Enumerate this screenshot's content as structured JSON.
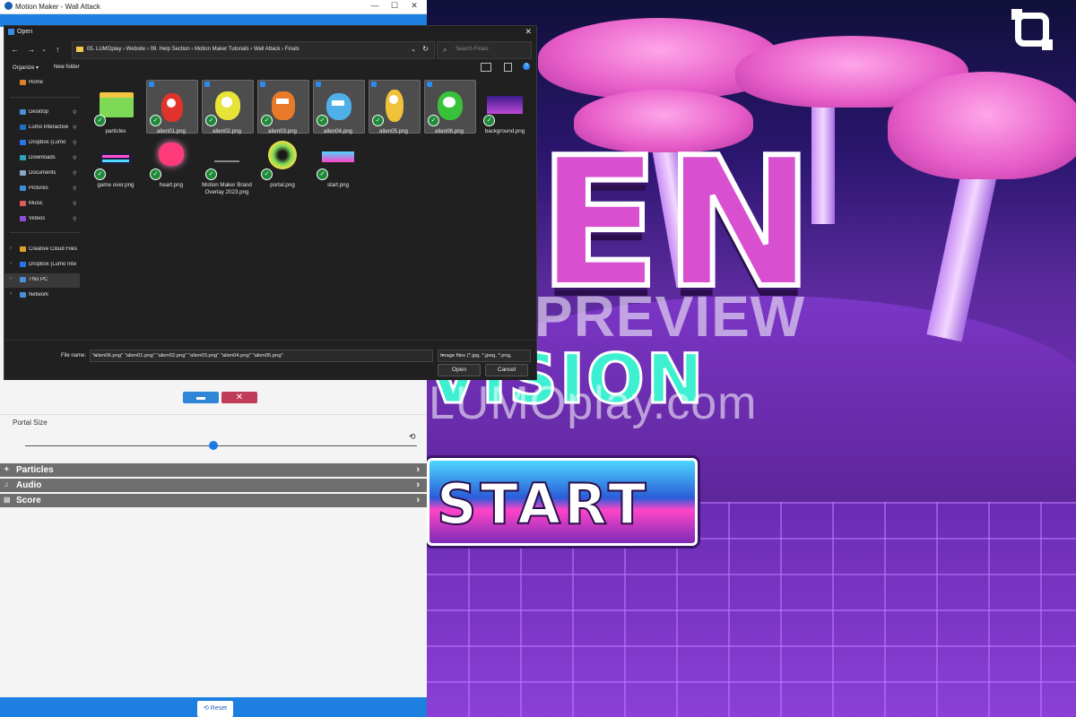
{
  "game": {
    "title_en": "EN",
    "title_vision": "VISION",
    "watermark_preview": "PREVIEW",
    "watermark_url": "LUMOplay.com",
    "start_label": "START"
  },
  "motion_maker": {
    "window_title": "Motion Maker - Wall Attack",
    "window_controls": [
      "—",
      "☐",
      "✕"
    ],
    "portal_size_label": "Portal Size",
    "portal_size_value": 0.48,
    "sections": [
      {
        "label": "Particles",
        "icon": "particles-icon"
      },
      {
        "label": "Audio",
        "icon": "audio-icon"
      },
      {
        "label": "Score",
        "icon": "score-icon"
      }
    ],
    "reset_label": "Reset"
  },
  "dialog": {
    "title": "Open",
    "path": "05. LUMOplay  ›  Website  ›  09. Help Section  ›  Motion Maker Tutorials  ›  Wall Attack  ›  Finals",
    "search_placeholder": "Search Finals",
    "organize_label": "Organize ▾",
    "new_folder_label": "New folder",
    "nav": [
      {
        "label": "Home",
        "icon_color": "#d9822b",
        "pinned": false
      },
      {
        "label": "Desktop",
        "icon_color": "#4a90d9",
        "pinned": true
      },
      {
        "label": "Lumo Interactive",
        "icon_color": "#1f6fbf",
        "pinned": true
      },
      {
        "label": "Dropbox (Lumo",
        "icon_color": "#2b74e6",
        "pinned": true
      },
      {
        "label": "Downloads",
        "icon_color": "#2fa3b8",
        "pinned": true
      },
      {
        "label": "Documents",
        "icon_color": "#8aa7c8",
        "pinned": true
      },
      {
        "label": "Pictures",
        "icon_color": "#3d8ed8",
        "pinned": true
      },
      {
        "label": "Music",
        "icon_color": "#e05a5a",
        "pinned": true
      },
      {
        "label": "Videos",
        "icon_color": "#8a4fd8",
        "pinned": true
      },
      {
        "label": "Creative Cloud Files",
        "icon_color": "#e0a030",
        "pinned": false
      },
      {
        "label": "Dropbox (Lumo Inte",
        "icon_color": "#2b74e6",
        "pinned": false
      },
      {
        "label": "This PC",
        "icon_color": "#4a90d9",
        "pinned": false
      },
      {
        "label": "Network",
        "icon_color": "#4a90d9",
        "pinned": false
      }
    ],
    "files": [
      {
        "name": "particles",
        "selected": false,
        "kind": "folder"
      },
      {
        "name": "alien01.png",
        "selected": true,
        "kind": "alien1"
      },
      {
        "name": "alien02.png",
        "selected": true,
        "kind": "alien2"
      },
      {
        "name": "alien03.png",
        "selected": true,
        "kind": "alien3"
      },
      {
        "name": "alien04.png",
        "selected": true,
        "kind": "alien4"
      },
      {
        "name": "alien05.png",
        "selected": true,
        "kind": "alien5"
      },
      {
        "name": "alien06.png",
        "selected": true,
        "kind": "alien6"
      },
      {
        "name": "background.png",
        "selected": false,
        "kind": "bg"
      },
      {
        "name": "game over.png",
        "selected": false,
        "kind": "gameover"
      },
      {
        "name": "heart.png",
        "selected": false,
        "kind": "heart"
      },
      {
        "name": "Motion Maker Brand Overlay 2023.png",
        "selected": false,
        "kind": "overlay"
      },
      {
        "name": "portal.png",
        "selected": false,
        "kind": "portal"
      },
      {
        "name": "start.png",
        "selected": false,
        "kind": "start"
      }
    ],
    "file_name_label": "File name:",
    "file_name_value": "\"alien06.png\" \"alien01.png\" \"alien02.png\" \"alien03.png\" \"alien04.png\" \"alien05.png\"",
    "filter_value": "Image files (*.jpg, *.jpeg, *.png,",
    "open_label": "Open",
    "cancel_label": "Cancel",
    "colors": {
      "accent": "#2d8bf0",
      "ok": "#1f8a3a"
    }
  }
}
